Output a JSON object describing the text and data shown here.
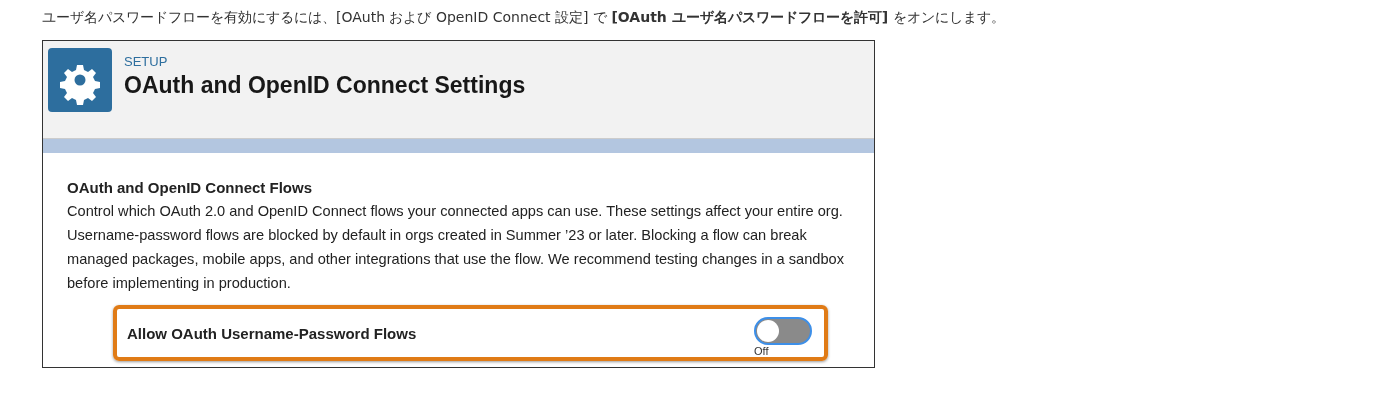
{
  "intro": "ユーザ名パスワードフローを有効にするには、[OAuth および OpenID Connect 設定] で **[OAuth ユーザ名パスワードフローを許可]** をオンにします。",
  "screenshot": {
    "header": {
      "eyebrow": "SETUP",
      "title": "OAuth and OpenID Connect Settings"
    },
    "section": {
      "heading": "OAuth and OpenID Connect Flows",
      "description": "Control which OAuth 2.0 and OpenID Connect flows your connected apps can use. These settings affect your entire org. Username-password flows are blocked by default in orgs created in Summer ’23 or later. Blocking a flow can break managed packages, mobile apps, and other integrations that use the flow. We recommend testing changes in a sandbox before implementing in production."
    },
    "setting": {
      "label": "Allow OAuth Username-Password Flows",
      "on": false,
      "state_label": "Off",
      "highlighted": true
    }
  }
}
